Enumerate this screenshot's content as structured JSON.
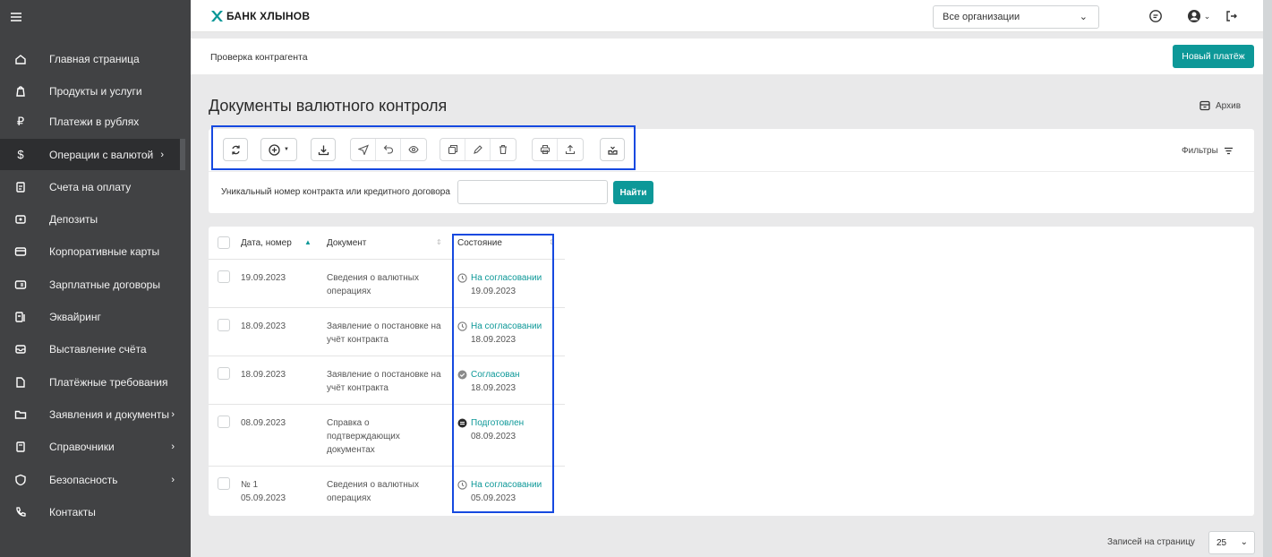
{
  "brand": {
    "name": "БАНК ХЛЫНОВ",
    "accent": "#0d9898"
  },
  "header": {
    "org_select": "Все организации"
  },
  "subbar": {
    "breadcrumb": "Проверка контрагента",
    "new_payment": "Новый платёж"
  },
  "sidebar": {
    "items": [
      {
        "label": "Главная страница"
      },
      {
        "label": "Продукты и услуги"
      },
      {
        "label": "Платежи в рублях"
      },
      {
        "label": "Операции с валютой"
      },
      {
        "label": "Счета на оплату"
      },
      {
        "label": "Депозиты"
      },
      {
        "label": "Корпоративные карты"
      },
      {
        "label": "Зарплатные договоры"
      },
      {
        "label": "Эквайринг"
      },
      {
        "label": "Выставление счёта"
      },
      {
        "label": "Платёжные требования"
      },
      {
        "label": "Заявления и документы"
      },
      {
        "label": "Справочники"
      },
      {
        "label": "Безопасность"
      },
      {
        "label": "Контакты"
      }
    ]
  },
  "page": {
    "title": "Документы валютного контроля",
    "archive": "Архив"
  },
  "toolbar": {
    "filters": "Фильтры"
  },
  "search": {
    "label": "Уникальный номер контракта или кредитного договора",
    "value": "",
    "button": "Найти"
  },
  "table": {
    "columns": [
      "Дата, номер",
      "Документ",
      "Состояние"
    ],
    "rows": [
      {
        "number": "",
        "date": "19.09.2023",
        "doc1": "Сведения о валютных",
        "doc2": "операциях",
        "doc3": "",
        "status": "На согласовании",
        "status_date": "19.09.2023",
        "status_icon": "clock-icon"
      },
      {
        "number": "",
        "date": "18.09.2023",
        "doc1": "Заявление о постановке на",
        "doc2": "учёт контракта",
        "doc3": "",
        "status": "На согласовании",
        "status_date": "18.09.2023",
        "status_icon": "clock-icon"
      },
      {
        "number": "",
        "date": "18.09.2023",
        "doc1": "Заявление о постановке на",
        "doc2": "учёт контракта",
        "doc3": "",
        "status": "Согласован",
        "status_date": "18.09.2023",
        "status_icon": "check-circle-icon"
      },
      {
        "number": "",
        "date": "08.09.2023",
        "doc1": "Справка о",
        "doc2": "подтверждающих",
        "doc3": "документах",
        "status": "Подготовлен",
        "status_date": "08.09.2023",
        "status_icon": "minus-circle-icon"
      },
      {
        "number": "№ 1",
        "date": "05.09.2023",
        "doc1": "Сведения о валютных",
        "doc2": "операциях",
        "doc3": "",
        "status": "На согласовании",
        "status_date": "05.09.2023",
        "status_icon": "clock-icon"
      }
    ]
  },
  "pagination": {
    "label": "Записей на страницу",
    "value": "25"
  }
}
